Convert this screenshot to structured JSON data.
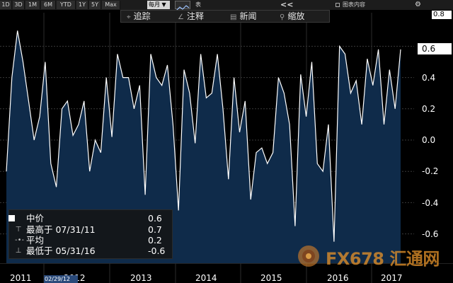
{
  "toolbar": {
    "ranges": [
      "1D",
      "3D",
      "1M",
      "6M",
      "YTD",
      "1Y",
      "5Y",
      "Max"
    ],
    "frequency": "每月 ▼",
    "table_label": "表",
    "collapse_symbol": "<<",
    "chart_content_label": "图表内容",
    "settings_symbol": "⚙"
  },
  "annotation_bar": {
    "items": [
      {
        "icon": "⌖",
        "label": "追踪"
      },
      {
        "icon": "∠",
        "label": "注释"
      },
      {
        "icon": "▤",
        "label": "新闻"
      },
      {
        "icon": "⚲",
        "label": "缩放"
      }
    ]
  },
  "axis": {
    "y_max_box": "0.8",
    "last_value_tag": "0.6",
    "crosshair_date": "02/29/12"
  },
  "legend": {
    "rows": [
      {
        "mark": "□",
        "label": "中价",
        "value": "0.6"
      },
      {
        "mark": "⊤",
        "label": "最高于 07/31/11",
        "value": "0.7"
      },
      {
        "mark": "-•-",
        "label": "平均",
        "value": "0.2"
      },
      {
        "mark": "⊥",
        "label": "最低于 05/31/16",
        "value": "-0.6"
      }
    ]
  },
  "watermark": {
    "text": "FX678 汇通网"
  },
  "colors": {
    "fill": "#0f2b4a",
    "line": "#ffffff",
    "background": "#000000"
  },
  "chart_data": {
    "type": "area",
    "ylim": [
      -0.8,
      0.8
    ],
    "yticks": [
      0.6,
      0.4,
      0.2,
      0.0,
      -0.2,
      -0.4,
      -0.6
    ],
    "ytick_labels": [
      "0.6",
      "0.4",
      "0.2",
      "0.0",
      "-0.2",
      "-0.4",
      "-0.6"
    ],
    "xtick_labels": [
      "2011",
      "2012",
      "2013",
      "2014",
      "2015",
      "2016",
      "2017"
    ],
    "x": [
      "2011-02",
      "2011-03",
      "2011-04",
      "2011-05",
      "2011-06",
      "2011-07",
      "2011-08",
      "2011-09",
      "2011-10",
      "2011-11",
      "2011-12",
      "2012-01",
      "2012-02",
      "2012-03",
      "2012-04",
      "2012-05",
      "2012-06",
      "2012-07",
      "2012-08",
      "2012-09",
      "2012-10",
      "2012-11",
      "2012-12",
      "2013-01",
      "2013-02",
      "2013-03",
      "2013-04",
      "2013-05",
      "2013-06",
      "2013-07",
      "2013-08",
      "2013-09",
      "2013-10",
      "2013-11",
      "2013-12",
      "2014-01",
      "2014-02",
      "2014-03",
      "2014-04",
      "2014-05",
      "2014-06",
      "2014-07",
      "2014-08",
      "2014-09",
      "2014-10",
      "2014-11",
      "2014-12",
      "2015-01",
      "2015-02",
      "2015-03",
      "2015-04",
      "2015-05",
      "2015-06",
      "2015-07",
      "2015-08",
      "2015-09",
      "2015-10",
      "2015-11",
      "2015-12",
      "2016-01",
      "2016-02",
      "2016-03",
      "2016-04",
      "2016-05",
      "2016-06",
      "2016-07",
      "2016-08",
      "2016-09",
      "2016-10",
      "2016-11",
      "2016-12",
      "2017-01",
      "2017-02",
      "2017-03",
      "2017-04",
      "2017-05",
      "2017-06",
      "2017-07",
      "2017-08"
    ],
    "series": [
      {
        "values": [
          -0.2,
          0.4,
          0.7,
          0.5,
          0.25,
          0.0,
          0.15,
          0.5,
          -0.15,
          -0.3,
          0.2,
          0.25,
          0.03,
          0.1,
          0.25,
          -0.2,
          0.0,
          -0.08,
          0.4,
          0.02,
          0.55,
          0.4,
          0.4,
          0.2,
          0.35,
          -0.35,
          0.55,
          0.4,
          0.35,
          0.48,
          0.1,
          -0.45,
          0.45,
          0.3,
          -0.02,
          0.55,
          0.27,
          0.3,
          0.55,
          0.2,
          -0.25,
          0.4,
          0.05,
          0.25,
          -0.38,
          -0.08,
          -0.05,
          -0.15,
          -0.08,
          0.4,
          0.3,
          0.1,
          -0.55,
          0.42,
          0.15,
          0.5,
          -0.15,
          -0.2,
          0.1,
          -0.65,
          0.6,
          0.55,
          0.3,
          0.38,
          0.1,
          0.52,
          0.35,
          0.58,
          0.1,
          0.45,
          0.2,
          0.58
        ]
      }
    ]
  }
}
